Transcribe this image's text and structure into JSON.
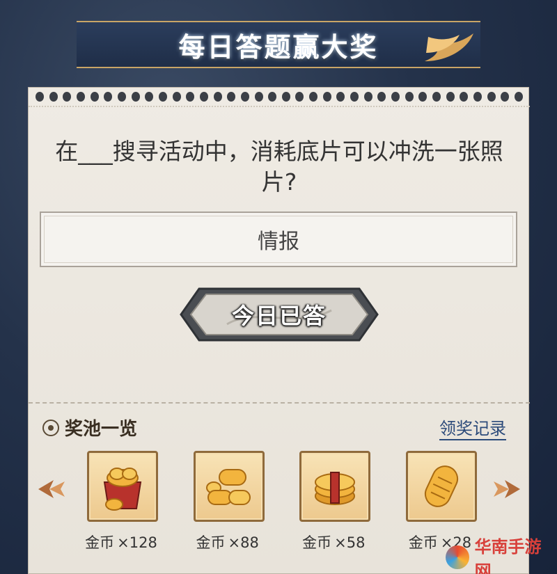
{
  "header": {
    "title": "每日答题赢大奖"
  },
  "question": {
    "text": "在___搜寻活动中，消耗底片可以冲洗一张照片?",
    "answer": "情报"
  },
  "status_button": {
    "label": "今日已答"
  },
  "prize_pool": {
    "title": "奖池一览",
    "claim_records_link": "领奖记录",
    "rewards": [
      {
        "label": "金币",
        "amount": "×128",
        "icon": "gold-coin-box-icon"
      },
      {
        "label": "金币",
        "amount": "×88",
        "icon": "gold-coin-pile-icon"
      },
      {
        "label": "金币",
        "amount": "×58",
        "icon": "gold-coin-stack-icon"
      },
      {
        "label": "金币",
        "amount": "×28",
        "icon": "gold-coin-roll-icon"
      }
    ]
  },
  "watermark": {
    "text": "华南手游网"
  },
  "colors": {
    "background": "#1f2e48",
    "paper": "#ece8e0",
    "gold": "#e8b24a",
    "link": "#2b4a7a"
  }
}
